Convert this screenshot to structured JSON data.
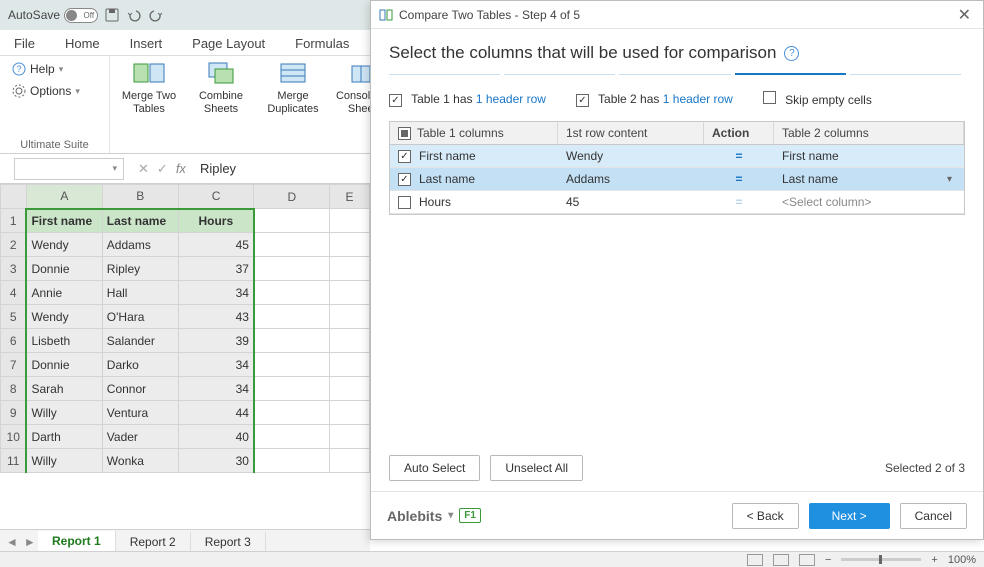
{
  "titlebar": {
    "autosave": "AutoSave",
    "toggle": "Off"
  },
  "ribbon_tabs": [
    "File",
    "Home",
    "Insert",
    "Page Layout",
    "Formulas"
  ],
  "ribbon": {
    "help": "Help",
    "options": "Options",
    "group1_label": "Ultimate Suite",
    "merge_two_tables": "Merge Two Tables",
    "combine_sheets": "Combine Sheets",
    "merge_duplicates": "Merge Duplicates",
    "consolidate_sheets": "Consolidate Sheets"
  },
  "formula_bar": {
    "namebox": "",
    "value": "Ripley"
  },
  "sheet": {
    "columns": [
      "A",
      "B",
      "C",
      "D",
      "E"
    ],
    "headers": [
      "First name",
      "Last name",
      "Hours"
    ],
    "rows": [
      [
        "Wendy",
        "Addams",
        "45"
      ],
      [
        "Donnie",
        "Ripley",
        "37"
      ],
      [
        "Annie",
        "Hall",
        "34"
      ],
      [
        "Wendy",
        "O'Hara",
        "43"
      ],
      [
        "Lisbeth",
        "Salander",
        "39"
      ],
      [
        "Donnie",
        "Darko",
        "34"
      ],
      [
        "Sarah",
        "Connor",
        "34"
      ],
      [
        "Willy",
        "Ventura",
        "44"
      ],
      [
        "Darth",
        "Vader",
        "40"
      ],
      [
        "Willy",
        "Wonka",
        "30"
      ]
    ],
    "tabs": [
      "Report 1",
      "Report 2",
      "Report 3"
    ]
  },
  "statusbar": {
    "zoom": "100%"
  },
  "dialog": {
    "title": "Compare Two Tables - Step 4 of 5",
    "heading": "Select the columns that will be used for comparison",
    "table1_has": "Table 1  has",
    "table2_has": "Table 2 has",
    "header_link": "1 header row",
    "skip_empty": "Skip empty cells",
    "col_headers": {
      "c1": "Table 1 columns",
      "c2": "1st row content",
      "c3": "Action",
      "c4": "Table 2 columns"
    },
    "rows": [
      {
        "checked": true,
        "col1": "First name",
        "content": "Wendy",
        "action": "=",
        "col2": "First name",
        "sel": "sel"
      },
      {
        "checked": true,
        "col1": "Last name",
        "content": "Addams",
        "action": "=",
        "col2": "Last name",
        "sel": "sel2",
        "chevron": true
      },
      {
        "checked": false,
        "col1": "Hours",
        "content": "45",
        "action": "=",
        "col2": "<Select column>",
        "placeholder": true
      }
    ],
    "auto_select": "Auto Select",
    "unselect_all": "Unselect All",
    "selected": "Selected 2 of 3",
    "brand": "Ablebits",
    "f1": "F1",
    "back": "< Back",
    "next": "Next >",
    "cancel": "Cancel"
  }
}
